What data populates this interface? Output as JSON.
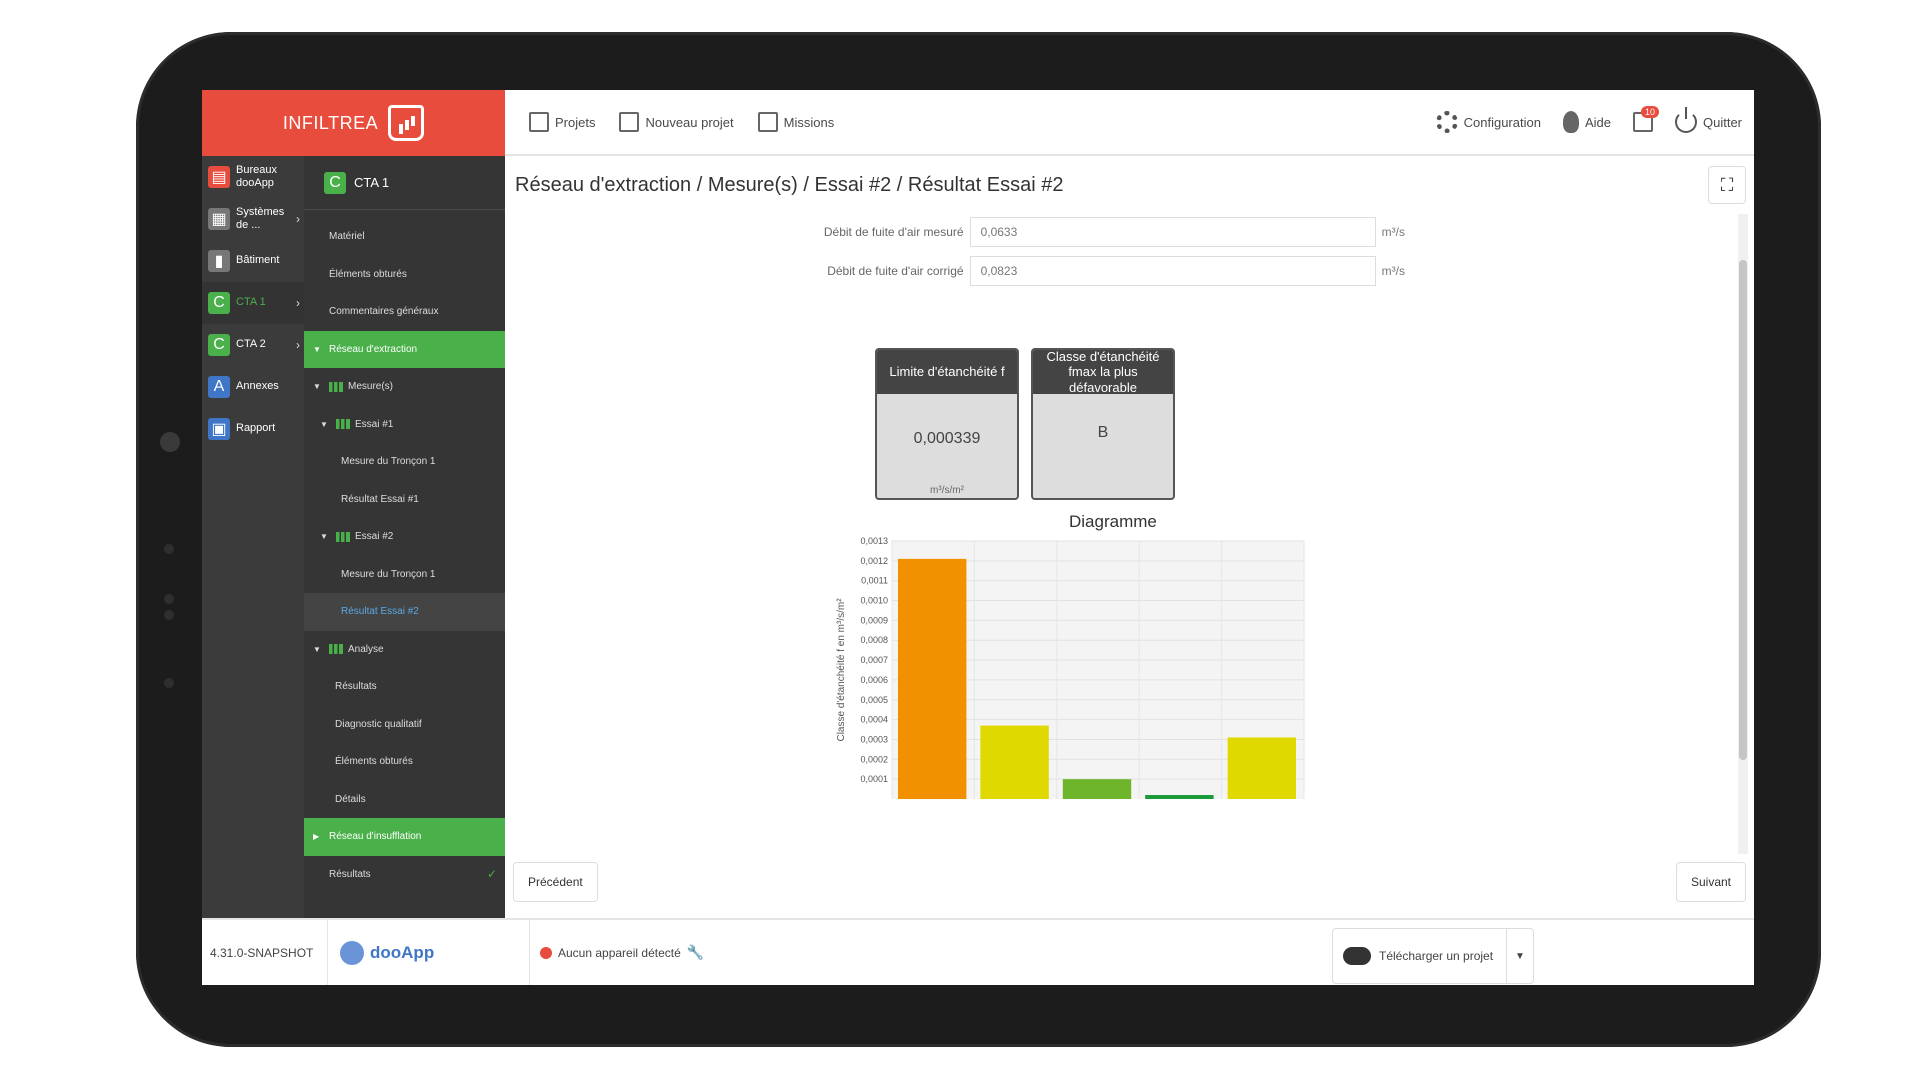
{
  "app": {
    "logo_text": "INFILTREA"
  },
  "topbar": {
    "left": [
      {
        "label": "Projets",
        "icon": "projects-icon"
      },
      {
        "label": "Nouveau projet",
        "icon": "edit-icon"
      },
      {
        "label": "Missions",
        "icon": "calendar-icon"
      }
    ],
    "right": [
      {
        "label": "Configuration",
        "icon": "gear-icon"
      },
      {
        "label": "Aide",
        "icon": "bulb-icon"
      },
      {
        "label": "",
        "icon": "notifications-icon",
        "badge": "10"
      },
      {
        "label": "Quitter",
        "icon": "power-icon"
      }
    ]
  },
  "sidebar1": [
    {
      "label": "Bureaux dooApp",
      "icon": "office-icon",
      "icon_char": "▤",
      "color": "#e84c3d",
      "arrow": false
    },
    {
      "label": "Systèmes de ...",
      "icon": "system-icon",
      "icon_char": "▦",
      "color": "#777777",
      "arrow": true
    },
    {
      "label": "Bâtiment",
      "icon": "building-icon",
      "icon_char": "▮",
      "color": "#777777",
      "arrow": false
    },
    {
      "label": "CTA 1",
      "icon": "cta-icon",
      "icon_char": "C",
      "color": "#49b04a",
      "arrow": true,
      "active": true
    },
    {
      "label": "CTA 2",
      "icon": "cta-icon",
      "icon_char": "C",
      "color": "#49b04a",
      "arrow": true
    },
    {
      "label": "Annexes",
      "icon": "annex-icon",
      "icon_char": "A",
      "color": "#3f76c7",
      "arrow": false
    },
    {
      "label": "Rapport",
      "icon": "report-icon",
      "icon_char": "▣",
      "color": "#3f76c7",
      "arrow": false
    }
  ],
  "sidebar2": {
    "header": "CTA 1",
    "header_icon": "C",
    "items": [
      {
        "label": "Matériel",
        "indent": 25
      },
      {
        "label": "Éléments obturés",
        "indent": 25
      },
      {
        "label": "Commentaires généraux",
        "indent": 25
      },
      {
        "label": "Réseau d'extraction",
        "indent": 25,
        "style": "green",
        "caret": "▼"
      },
      {
        "label": "Mesure(s)",
        "indent": 25,
        "caret": "▼",
        "chart": true
      },
      {
        "label": "Essai #1",
        "indent": 32,
        "caret": "▼",
        "chart": true
      },
      {
        "label": "Mesure du Tronçon 1",
        "indent": 37
      },
      {
        "label": "Résultat Essai #1",
        "indent": 37
      },
      {
        "label": "Essai #2",
        "indent": 32,
        "caret": "▼",
        "chart": true
      },
      {
        "label": "Mesure du Tronçon 1",
        "indent": 37
      },
      {
        "label": "Résultat Essai #2",
        "indent": 37,
        "style": "selected"
      },
      {
        "label": "Analyse",
        "indent": 25,
        "caret": "▼",
        "chart": true
      },
      {
        "label": "Résultats",
        "indent": 31
      },
      {
        "label": "Diagnostic qualitatif",
        "indent": 31
      },
      {
        "label": "Éléments obturés",
        "indent": 31
      },
      {
        "label": "Détails",
        "indent": 31
      },
      {
        "label": "Réseau d'insufflation",
        "indent": 25,
        "style": "green",
        "caret": "▶"
      },
      {
        "label": "Résultats",
        "indent": 25,
        "check": true
      }
    ]
  },
  "main": {
    "breadcrumb": "Réseau d'extraction / Mesure(s) / Essai #2 / Résultat Essai #2",
    "fields": [
      {
        "label": "Débit de fuite d'air mesuré",
        "value": "0,0633",
        "unit": "m³/s"
      },
      {
        "label": "Débit de fuite d'air corrigé",
        "value": "0,0823",
        "unit": "m³/s"
      }
    ],
    "cards": [
      {
        "title": "Limite d'étanchéité f",
        "value": "0,000339",
        "unit": "m³/s/m²"
      },
      {
        "title": "Classe d'étanchéité fmax la plus défavorable",
        "value": "B",
        "unit": ""
      }
    ],
    "diagram_title": "Diagramme",
    "prev": "Précédent",
    "next": "Suivant"
  },
  "chart_data": {
    "type": "bar",
    "title": "Diagramme",
    "ylabel": "Classe d'étanchéité f en m³/s/m²",
    "xlabel": "",
    "ylim": [
      0,
      0.0013
    ],
    "yticks": [
      "0,0001",
      "0,0002",
      "0,0003",
      "0,0004",
      "0,0005",
      "0,0006",
      "0,0007",
      "0,0008",
      "0,0009",
      "0,0010",
      "0,0011",
      "0,0012",
      "0,0013"
    ],
    "values": [
      0.00121,
      0.00037,
      0.0001,
      2e-05,
      0.00031
    ],
    "colors": [
      "#f29100",
      "#e0d900",
      "#6fb52c",
      "#1a9a38",
      "#e0d900"
    ]
  },
  "footer": {
    "version": "4.31.0-SNAPSHOT",
    "brand": "dooApp",
    "status": "Aucun appareil détecté",
    "download": "Télécharger un projet"
  }
}
